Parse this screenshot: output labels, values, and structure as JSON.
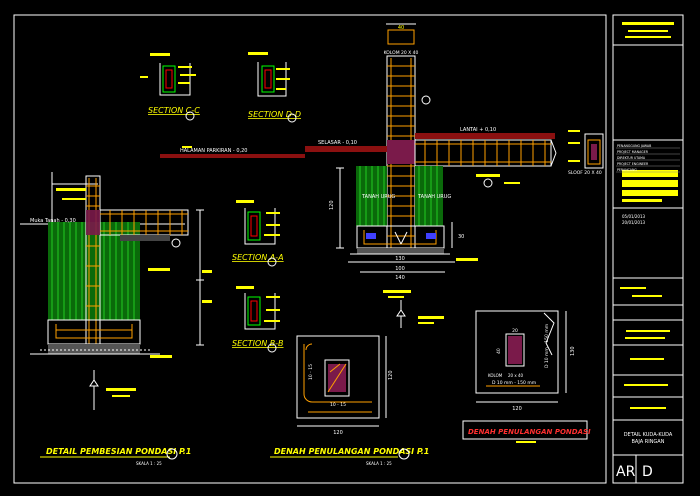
{
  "sections": {
    "cc": "SECTION C-C",
    "dd": "SECTION D-D",
    "aa": "SECTION A-A",
    "bb": "SECTION B-B"
  },
  "column": {
    "top_dim": "40",
    "label": "KOLOM 20 X 40",
    "lantai": "LANTAI + 0,10",
    "selasar": "SELASAR - 0,10",
    "halaman": "HALAMAN PARKIRAN - 0,20",
    "sloof": "SLOOF 20 X 40",
    "tanah_urug_1": "TANAH URUG",
    "tanah_urug_2": "TANAH URUG",
    "dim_120": "120",
    "dim_30": "30",
    "dim_130": "130",
    "dim_100": "100",
    "dim_140": "140"
  },
  "left_detail": {
    "muka_tanah": "Muka Tanah - 0,30",
    "title": "DETAIL PEMBESIAN PONDASI P.1",
    "scale": "SKALA 1 : 25"
  },
  "plan1": {
    "rebar": "10 - 15",
    "rebar2": "10 - 15",
    "dim_right": "120",
    "dim_bottom": "120",
    "title": "DENAH PENULANGAN PONDASI P.1",
    "scale": "SKALA 1 : 25"
  },
  "plan2": {
    "dim_top": "20",
    "kolom": "KOLOM",
    "kolom_size": "20 x 40",
    "dim_side": "40",
    "rebar_v": "D 10 mm - 150 mm",
    "rebar_h": "D 10 mm - 150 mm",
    "dim_right": "130",
    "dim_bottom": "120",
    "title": "DENAH PENULANGAN PONDASI"
  },
  "title_block": {
    "rows": [
      "PENANGGUNG JAWAB",
      "PROJECT MANAGER",
      "DIREKTUR UTAMA",
      "PROJECT ENGINEER",
      "PERANCANG"
    ],
    "date1": "05/01/2013",
    "date2": "20/01/2013",
    "detail_line1": "DETAIL KUDA-KUDA",
    "detail_line2": "BAJA RINGAN",
    "code_a": "AR",
    "code_b": "D"
  }
}
